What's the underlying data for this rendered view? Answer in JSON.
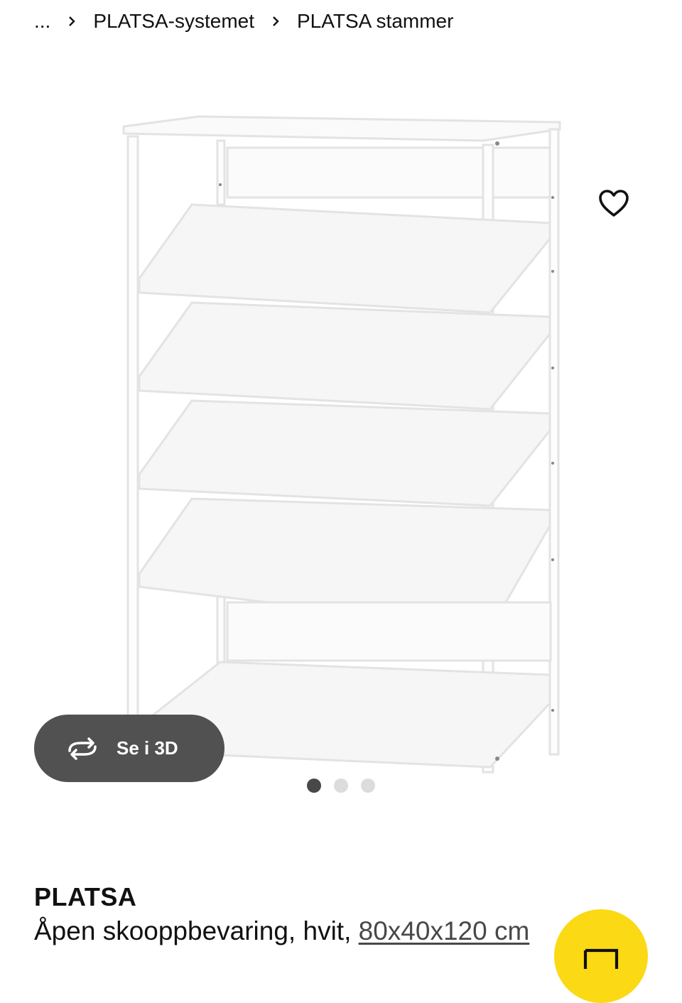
{
  "breadcrumb": {
    "items": [
      "...",
      "PLATSA-systemet",
      "PLATSA stammer"
    ]
  },
  "gallery": {
    "view_3d_label": "Se i 3D",
    "dots": [
      {
        "active": true
      },
      {
        "active": false
      },
      {
        "active": false
      }
    ]
  },
  "product": {
    "name": "PLATSA",
    "description": "Åpen skooppbevaring, hvit,",
    "dimensions": "80x40x120 cm"
  },
  "colors": {
    "cart_button": "#fbd914",
    "view_3d_button": "#515151",
    "dot_active": "#484848",
    "dot_inactive": "#dcdcdc"
  },
  "icons": {
    "favorite": "heart-icon",
    "view_3d": "rotate-3d-icon",
    "cart": "shopping-bag-icon",
    "breadcrumb_separator": "chevron-right-icon"
  }
}
